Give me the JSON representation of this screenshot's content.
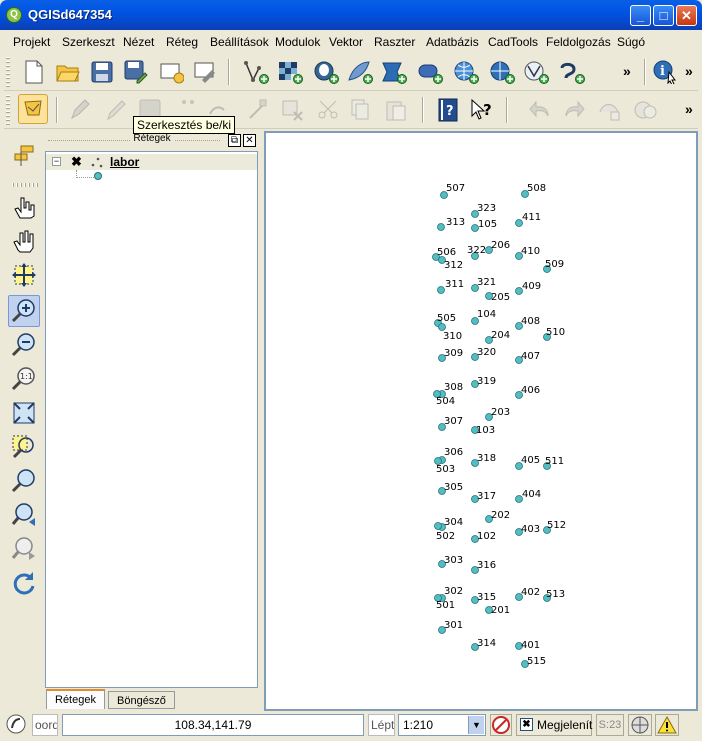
{
  "window": {
    "title": "QGISd647354",
    "app_icon": "Q"
  },
  "menu": [
    {
      "label": "Projekt"
    },
    {
      "label": "Szerkeszt"
    },
    {
      "label": "Nézet"
    },
    {
      "label": "Réteg"
    },
    {
      "label": "Beállítások"
    },
    {
      "label": "Modulok"
    },
    {
      "label": "Vektor"
    },
    {
      "label": "Raszter"
    },
    {
      "label": "Adatbázis"
    },
    {
      "label": "CadTools"
    },
    {
      "label": "Feldolgozás"
    },
    {
      "label": "Súgó"
    }
  ],
  "toolbar": {
    "more_label": "»",
    "tooltip": "Szerkesztés be/ki"
  },
  "layers_panel": {
    "title": "Rétegek",
    "layer_name": "labor",
    "float_btn": "⧉",
    "close_btn": "✕"
  },
  "tabs": {
    "layers": "Rétegek",
    "browser": "Böngésző"
  },
  "status": {
    "coord_label": "oordinát",
    "coord_value": "108.34,141.79",
    "scale_label": "Lépték",
    "scale_value": "1:210",
    "render_label": "Megjelenít",
    "epsg": "S:23"
  },
  "map_points": [
    {
      "label": "507"
    },
    {
      "label": "508"
    },
    {
      "label": "323"
    },
    {
      "label": "313"
    },
    {
      "label": "105"
    },
    {
      "label": "411"
    },
    {
      "label": "506"
    },
    {
      "label": "322"
    },
    {
      "label": "206"
    },
    {
      "label": "410"
    },
    {
      "label": "312"
    },
    {
      "label": "509"
    },
    {
      "label": "321"
    },
    {
      "label": "311"
    },
    {
      "label": "409"
    },
    {
      "label": "205"
    },
    {
      "label": "104"
    },
    {
      "label": "505"
    },
    {
      "label": "408"
    },
    {
      "label": "310"
    },
    {
      "label": "204"
    },
    {
      "label": "510"
    },
    {
      "label": "309"
    },
    {
      "label": "320"
    },
    {
      "label": "407"
    },
    {
      "label": "319"
    },
    {
      "label": "308"
    },
    {
      "label": "406"
    },
    {
      "label": "504"
    },
    {
      "label": "203"
    },
    {
      "label": "307"
    },
    {
      "label": "103"
    },
    {
      "label": "306"
    },
    {
      "label": "318"
    },
    {
      "label": "405"
    },
    {
      "label": "511"
    },
    {
      "label": "503"
    },
    {
      "label": "305"
    },
    {
      "label": "317"
    },
    {
      "label": "404"
    },
    {
      "label": "202"
    },
    {
      "label": "304"
    },
    {
      "label": "403"
    },
    {
      "label": "512"
    },
    {
      "label": "502"
    },
    {
      "label": "102"
    },
    {
      "label": "303"
    },
    {
      "label": "316"
    },
    {
      "label": "302"
    },
    {
      "label": "402"
    },
    {
      "label": "315"
    },
    {
      "label": "513"
    },
    {
      "label": "501"
    },
    {
      "label": "201"
    },
    {
      "label": "301"
    },
    {
      "label": "314"
    },
    {
      "label": "401"
    },
    {
      "label": "515"
    }
  ],
  "colors": {
    "point_fill": "#4fbfc4",
    "point_stroke": "#2c6e74",
    "titlebar": "#0054e3"
  }
}
